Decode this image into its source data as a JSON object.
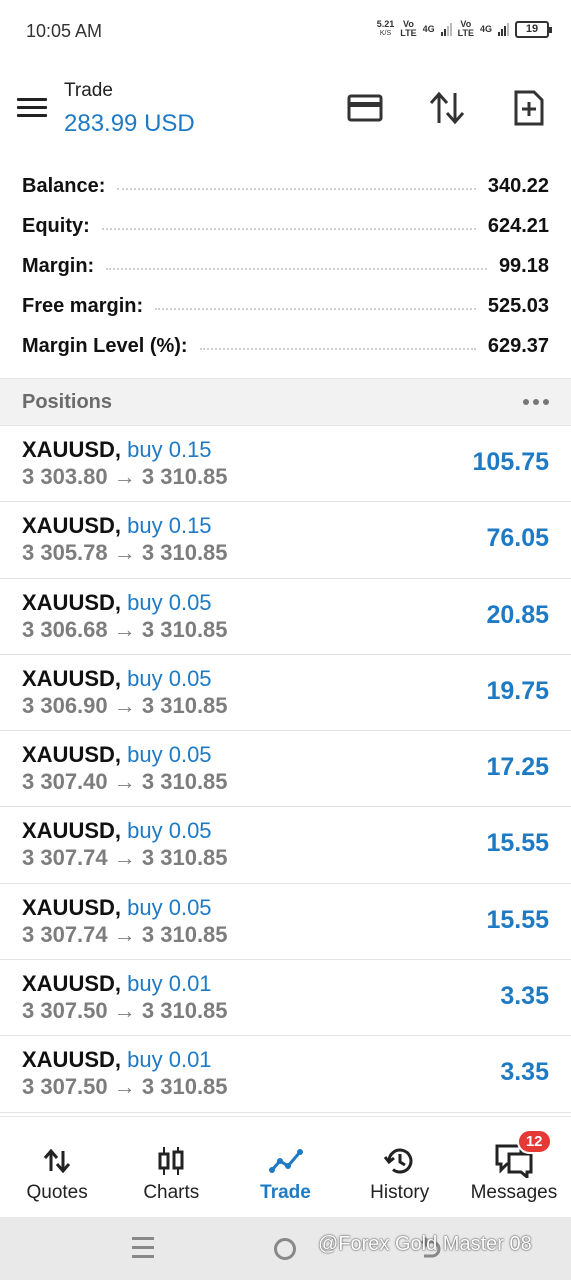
{
  "status_bar": {
    "time": "10:05 AM",
    "speed_value": "5.21",
    "speed_unit": "K/S",
    "sim1": {
      "carrier": "Vo",
      "tech": "LTE",
      "net": "4G"
    },
    "sim2": {
      "carrier": "Vo",
      "tech": "LTE",
      "net": "4G"
    },
    "battery": "19"
  },
  "header": {
    "title": "Trade",
    "balance": "283.99 USD",
    "icons": [
      "menu-icon",
      "credit-card-icon",
      "sort-arrows-icon",
      "new-order-icon"
    ]
  },
  "summary": [
    {
      "label": "Balance:",
      "value": "340.22"
    },
    {
      "label": "Equity:",
      "value": "624.21"
    },
    {
      "label": "Margin:",
      "value": "99.18"
    },
    {
      "label": "Free margin:",
      "value": "525.03"
    },
    {
      "label": "Margin Level (%):",
      "value": "629.37"
    }
  ],
  "positions_header": "Positions",
  "positions": [
    {
      "symbol": "XAUUSD,",
      "side": "buy 0.15",
      "open": "3 303.80",
      "arrow": "→",
      "current": "3 310.85",
      "profit": "105.75"
    },
    {
      "symbol": "XAUUSD,",
      "side": "buy 0.15",
      "open": "3 305.78",
      "arrow": "→",
      "current": "3 310.85",
      "profit": "76.05"
    },
    {
      "symbol": "XAUUSD,",
      "side": "buy 0.05",
      "open": "3 306.68",
      "arrow": "→",
      "current": "3 310.85",
      "profit": "20.85"
    },
    {
      "symbol": "XAUUSD,",
      "side": "buy 0.05",
      "open": "3 306.90",
      "arrow": "→",
      "current": "3 310.85",
      "profit": "19.75"
    },
    {
      "symbol": "XAUUSD,",
      "side": "buy 0.05",
      "open": "3 307.40",
      "arrow": "→",
      "current": "3 310.85",
      "profit": "17.25"
    },
    {
      "symbol": "XAUUSD,",
      "side": "buy 0.05",
      "open": "3 307.74",
      "arrow": "→",
      "current": "3 310.85",
      "profit": "15.55"
    },
    {
      "symbol": "XAUUSD,",
      "side": "buy 0.05",
      "open": "3 307.74",
      "arrow": "→",
      "current": "3 310.85",
      "profit": "15.55"
    },
    {
      "symbol": "XAUUSD,",
      "side": "buy 0.01",
      "open": "3 307.50",
      "arrow": "→",
      "current": "3 310.85",
      "profit": "3.35"
    },
    {
      "symbol": "XAUUSD,",
      "side": "buy 0.01",
      "open": "3 307.50",
      "arrow": "→",
      "current": "3 310.85",
      "profit": "3.35"
    }
  ],
  "bottom_nav": [
    {
      "label": "Quotes",
      "icon": "quotes-icon"
    },
    {
      "label": "Charts",
      "icon": "candlestick-icon"
    },
    {
      "label": "Trade",
      "icon": "trade-line-icon",
      "active": true
    },
    {
      "label": "History",
      "icon": "history-icon"
    },
    {
      "label": "Messages",
      "icon": "messages-icon",
      "badge": "12"
    }
  ],
  "watermark": "@Forex Gold Master 08",
  "colors": {
    "accent": "#1f7ac4",
    "badge": "#e53935",
    "muted": "#7d7d7d"
  }
}
